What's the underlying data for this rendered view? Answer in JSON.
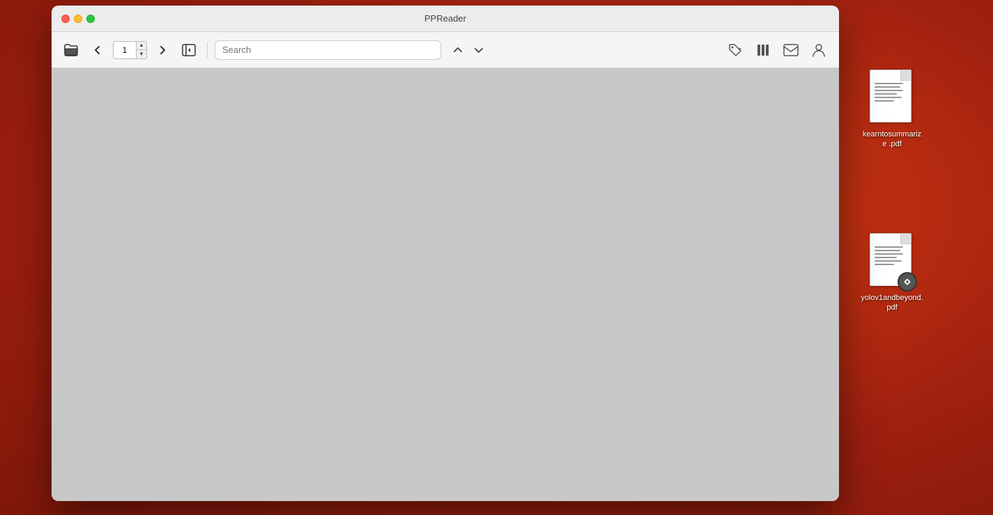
{
  "desktop": {
    "files": [
      {
        "id": "file-1",
        "name": "kearntosummarize\n.pdf",
        "has_overlay": false
      },
      {
        "id": "file-2",
        "name": "yolov1andbeyond.\npdf",
        "has_overlay": true
      }
    ]
  },
  "window": {
    "title": "PPReader",
    "traffic_lights": {
      "close": "close",
      "minimize": "minimize",
      "maximize": "maximize"
    }
  },
  "toolbar": {
    "open_folder_label": "📁",
    "prev_page_label": "‹",
    "next_page_label": "›",
    "current_page": "1",
    "toggle_sidebar_label": "◀",
    "search_placeholder": "Search",
    "search_prev_label": "∧",
    "search_next_label": "∨",
    "tag_icon_label": "🏷",
    "library_icon_label": "📚",
    "mail_icon_label": "✉",
    "user_icon_label": "👤"
  }
}
